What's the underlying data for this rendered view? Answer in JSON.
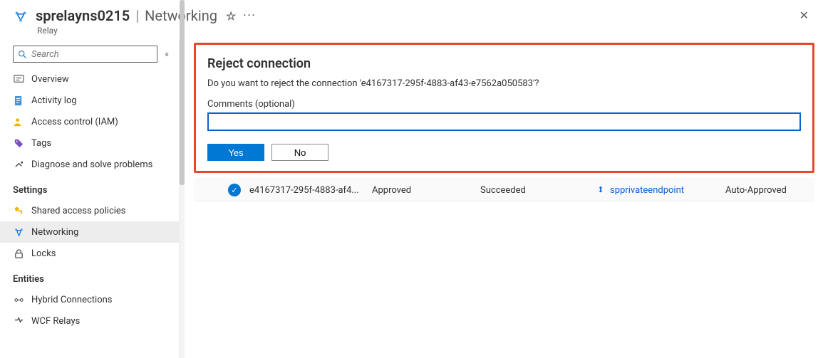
{
  "header": {
    "resource_name": "sprelayns0215",
    "section_name": "Networking",
    "resource_type": "Relay"
  },
  "sidebar": {
    "search_placeholder": "Search",
    "general_items": [
      {
        "label": "Overview"
      },
      {
        "label": "Activity log"
      },
      {
        "label": "Access control (IAM)"
      },
      {
        "label": "Tags"
      },
      {
        "label": "Diagnose and solve problems"
      }
    ],
    "settings_heading": "Settings",
    "settings_items": [
      {
        "label": "Shared access policies"
      },
      {
        "label": "Networking"
      },
      {
        "label": "Locks"
      }
    ],
    "entities_heading": "Entities",
    "entities_items": [
      {
        "label": "Hybrid Connections"
      },
      {
        "label": "WCF Relays"
      }
    ]
  },
  "dialog": {
    "title": "Reject connection",
    "message": "Do you want to reject the connection 'e4167317-295f-4883-af43-e7562a050583'?",
    "comments_label": "Comments (optional)",
    "comments_value": "",
    "yes_label": "Yes",
    "no_label": "No"
  },
  "connection_row": {
    "name": "e4167317-295f-4883-af4...",
    "connection_state": "Approved",
    "provisioning_state": "Succeeded",
    "private_endpoint": "spprivateendpoint",
    "description": "Auto-Approved"
  }
}
